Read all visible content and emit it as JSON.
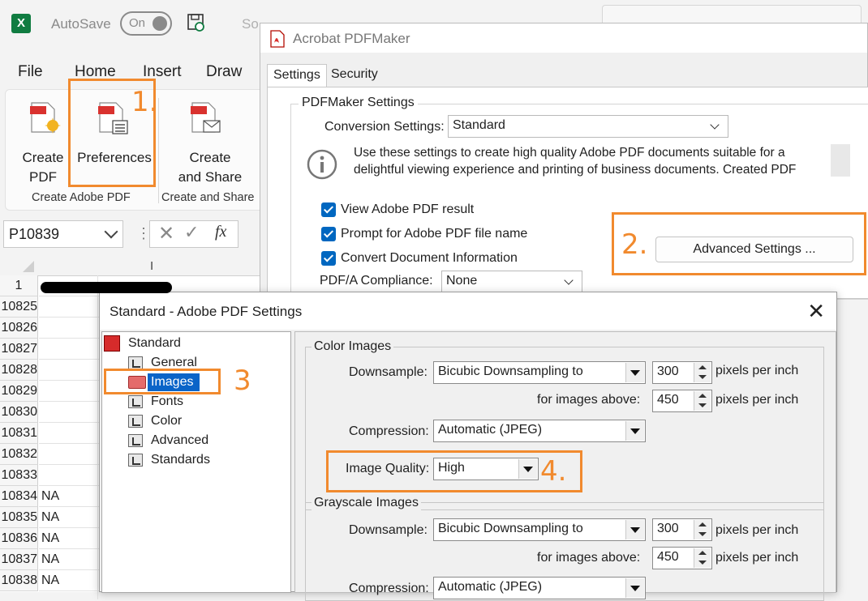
{
  "excel": {
    "logo": "X",
    "autosave_label": "AutoSave",
    "autosave_state": "On",
    "filename": "So...",
    "menu": [
      "File",
      "Home",
      "Insert",
      "Draw"
    ],
    "ribbon": {
      "create_pdf_line1": "Create",
      "create_pdf_line2": "PDF",
      "preferences": "Preferences",
      "create_share_line1": "Create",
      "create_share_line2": "and Share",
      "group_create_adobe_pdf": "Create Adobe PDF",
      "group_create_share": "Create and Share"
    },
    "name_box": "P10839",
    "formula_fx": "fx",
    "column_header": "I",
    "rows": [
      {
        "num": "1",
        "val": ""
      },
      {
        "num": "10825",
        "val": ""
      },
      {
        "num": "10826",
        "val": ""
      },
      {
        "num": "10827",
        "val": ""
      },
      {
        "num": "10828",
        "val": ""
      },
      {
        "num": "10829",
        "val": ""
      },
      {
        "num": "10830",
        "val": ""
      },
      {
        "num": "10831",
        "val": ""
      },
      {
        "num": "10832",
        "val": ""
      },
      {
        "num": "10833",
        "val": ""
      },
      {
        "num": "10834",
        "val": "NA"
      },
      {
        "num": "10835",
        "val": "NA"
      },
      {
        "num": "10836",
        "val": "NA"
      },
      {
        "num": "10837",
        "val": "NA"
      },
      {
        "num": "10838",
        "val": "NA"
      }
    ]
  },
  "pdfmaker": {
    "title": "Acrobat PDFMaker",
    "tabs": [
      "Settings",
      "Security"
    ],
    "group_title": "PDFMaker Settings",
    "conversion_label": "Conversion Settings:",
    "conversion_value": "Standard",
    "description_line1": "Use these settings to create high quality Adobe PDF documents suitable for a",
    "description_line2": "delightful viewing experience and printing of business documents.  Created PDF",
    "checkboxes": [
      "View Adobe PDF result",
      "Prompt for Adobe PDF file name",
      "Convert Document Information"
    ],
    "pdfa_label": "PDF/A Compliance:",
    "pdfa_value": "None",
    "advanced_button": "Advanced Settings ..."
  },
  "pdf_settings": {
    "title": "Standard - Adobe PDF Settings",
    "close": "✕",
    "tree_root": "Standard",
    "tree_items": [
      "General",
      "Images",
      "Fonts",
      "Color",
      "Advanced",
      "Standards"
    ],
    "color_images": {
      "title": "Color Images",
      "downsample_label": "Downsample:",
      "downsample_value": "Bicubic Downsampling to",
      "ppi_value": "300",
      "ppi_unit": "pixels per inch",
      "above_label": "for images above:",
      "above_value": "450",
      "above_unit": "pixels per inch",
      "compression_label": "Compression:",
      "compression_value": "Automatic (JPEG)",
      "quality_label": "Image Quality:",
      "quality_value": "High"
    },
    "grayscale_images": {
      "title": "Grayscale Images",
      "downsample_label": "Downsample:",
      "downsample_value": "Bicubic Downsampling to",
      "ppi_value": "300",
      "ppi_unit": "pixels per inch",
      "above_label": "for images above:",
      "above_value": "450",
      "above_unit": "pixels per inch",
      "compression_label": "Compression:",
      "compression_value": "Automatic (JPEG)"
    }
  },
  "annotations": {
    "step1": "1.",
    "step2": "2.",
    "step3": "3",
    "step4": "4."
  },
  "colors": {
    "annotation": "#f18a2e",
    "excel_green": "#107c41",
    "checkbox_blue": "#0067c0",
    "selection_blue": "#0a64c8"
  }
}
